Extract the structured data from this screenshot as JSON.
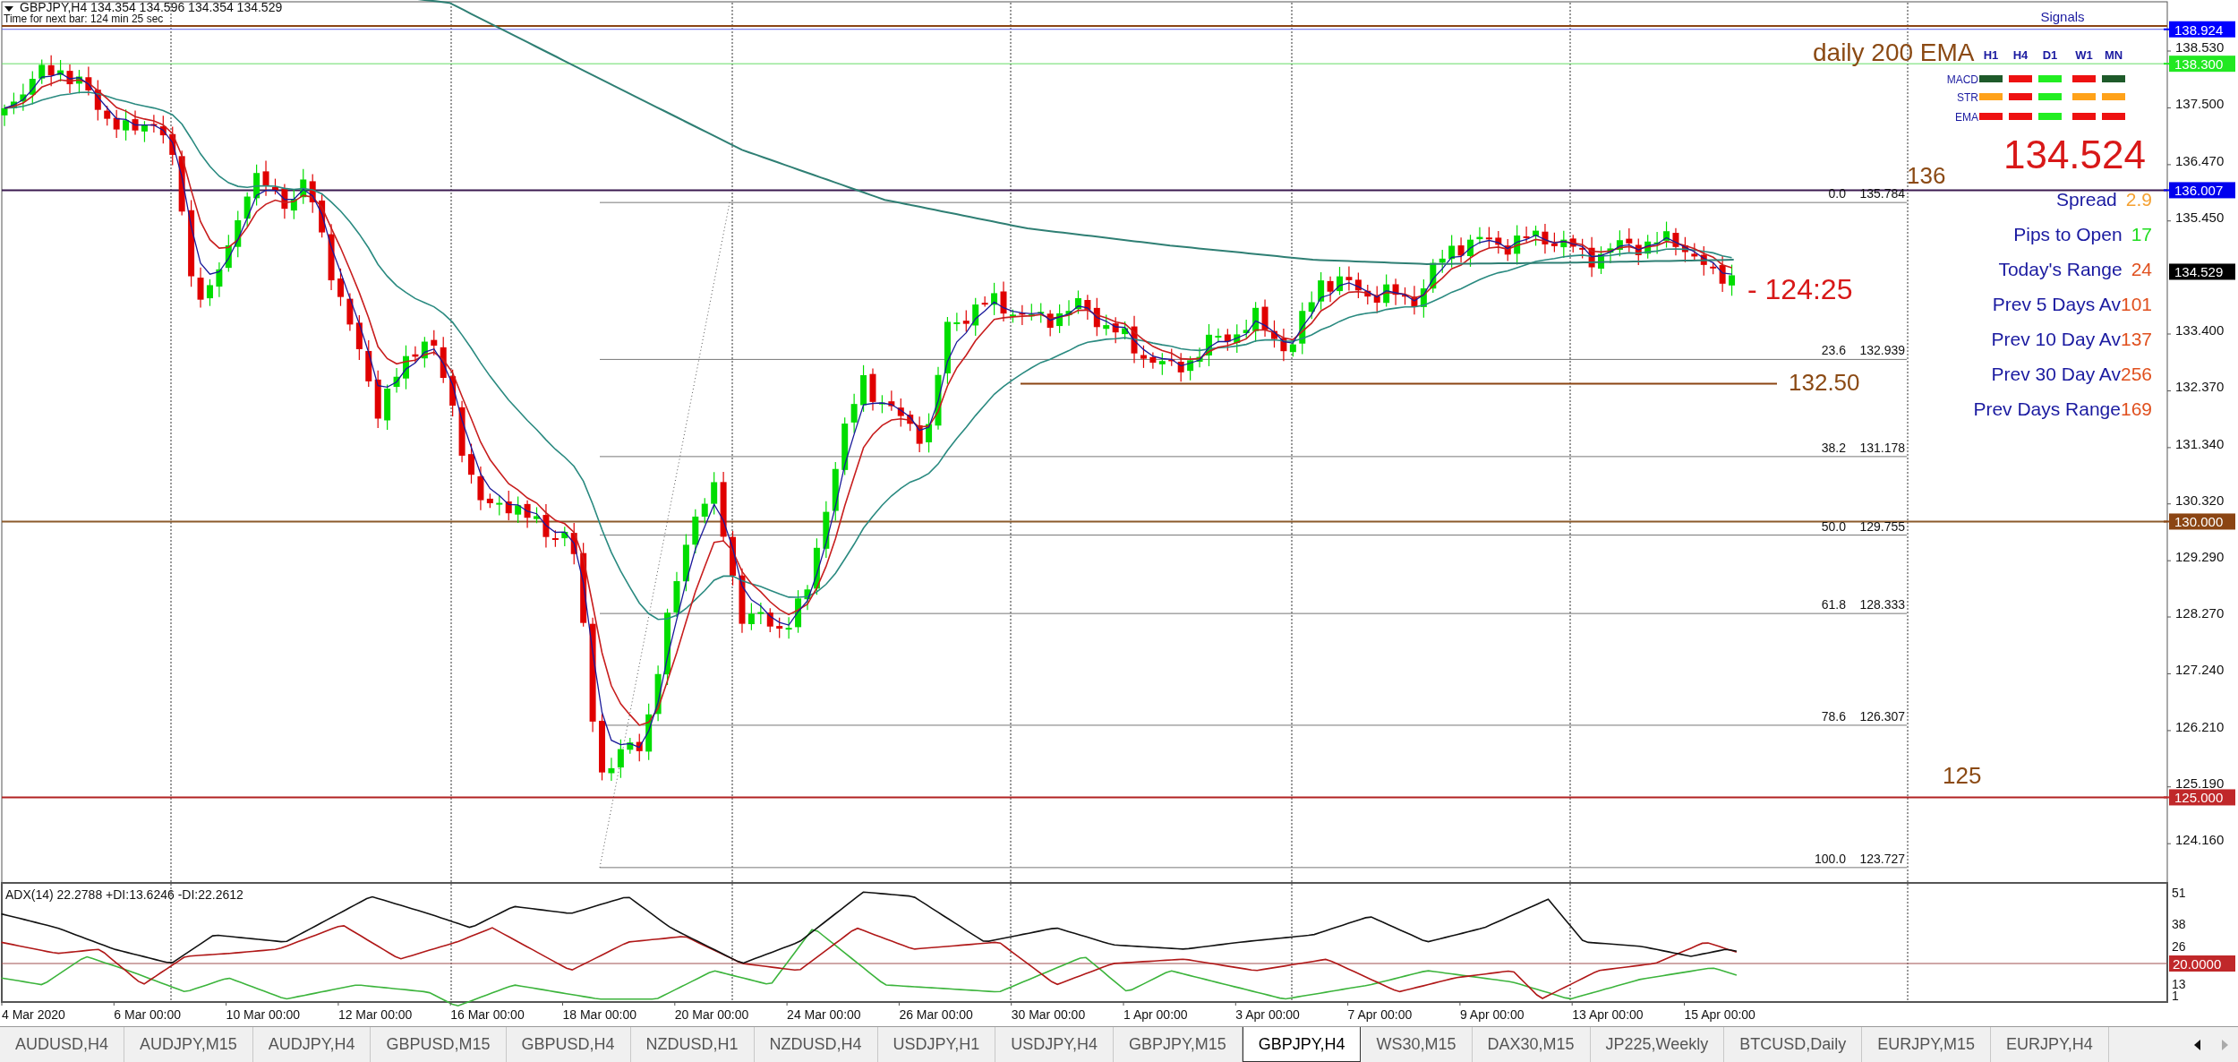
{
  "chart": {
    "title": "GBPJPY,H4  134.354 134.596 134.354 134.529",
    "timer": "Time for next bar: 124 min 25 sec",
    "price_axis": [
      "138.530",
      "137.500",
      "136.470",
      "135.450",
      "133.400",
      "132.370",
      "131.340",
      "130.320",
      "129.290",
      "128.270",
      "127.240",
      "126.210",
      "125.190",
      "124.160"
    ],
    "price_tags": [
      {
        "label": "138.924",
        "color": "#0000ff",
        "line": true
      },
      {
        "label": "138.300",
        "color": "#22e822",
        "line": true
      },
      {
        "label": "136.007",
        "color": "#0000ee",
        "line": true
      },
      {
        "label": "134.529",
        "color": "#000000",
        "line": false
      },
      {
        "label": "130.000",
        "color": "#8b4513",
        "line": true
      },
      {
        "label": "125.000",
        "color": "#c0282a",
        "line": true
      }
    ],
    "fibonacci": [
      {
        "level": "0.0",
        "price": "135.784"
      },
      {
        "level": "23.6",
        "price": "132.939"
      },
      {
        "level": "38.2",
        "price": "131.178"
      },
      {
        "level": "50.0",
        "price": "129.755"
      },
      {
        "level": "61.8",
        "price": "128.333"
      },
      {
        "level": "78.6",
        "price": "126.307"
      },
      {
        "level": "100.0",
        "price": "123.727"
      }
    ],
    "annotations": [
      {
        "text": "daily 200 EMA",
        "color": "#8b4a14"
      },
      {
        "text": "136",
        "color": "#8b4a14"
      },
      {
        "text": "132.50",
        "color": "#8b4a14"
      },
      {
        "text": "125",
        "color": "#8b4a14"
      },
      {
        "text": "- 124:25",
        "color": "#d81818"
      }
    ],
    "last_price": "134.524",
    "signals": {
      "title": "Signals",
      "columns": [
        "H1",
        "H4",
        "D1",
        "W1",
        "MN"
      ],
      "rows": [
        {
          "label": "MACD",
          "cells": [
            {
              "color": "#1e5a2a"
            },
            {
              "color": "#ee1111"
            },
            {
              "color": "#22ee22"
            },
            {
              "color": "#ee1111"
            },
            {
              "color": "#1e5a2a"
            }
          ]
        },
        {
          "label": "STR",
          "cells": [
            {
              "color": "#ffa21a"
            },
            {
              "color": "#ee1111"
            },
            {
              "color": "#22ee22"
            },
            {
              "color": "#ffa21a"
            },
            {
              "color": "#ffa21a"
            }
          ]
        },
        {
          "label": "EMA",
          "cells": [
            {
              "color": "#ee1111"
            },
            {
              "color": "#ee1111"
            },
            {
              "color": "#22ee22"
            },
            {
              "color": "#ee1111"
            },
            {
              "color": "#ee1111"
            }
          ]
        }
      ]
    },
    "stats": [
      {
        "label": "Spread",
        "value": "2.9",
        "color": "#f5a030"
      },
      {
        "label": "Pips to Open",
        "value": "17",
        "color": "#22dd22"
      },
      {
        "label": "Today's Range",
        "value": "24",
        "color": "#e0501e"
      },
      {
        "label": "Prev 5 Days Av",
        "value": "101",
        "color": "#e0501e"
      },
      {
        "label": "Prev 10 Day Av",
        "value": "137",
        "color": "#e0501e"
      },
      {
        "label": "Prev 30 Day Av",
        "value": "256",
        "color": "#e0501e"
      },
      {
        "label": "Prev Days Range",
        "value": "169",
        "color": "#e0501e"
      }
    ]
  },
  "indicator": {
    "label": "ADX(14) 22.2788 +DI:13.6246 -DI:22.2612",
    "axis": [
      "51",
      "38",
      "26",
      "13",
      "1"
    ],
    "tag": {
      "label": "20.0000",
      "color": "#c0282a"
    }
  },
  "time_axis": [
    "4 Mar 2020",
    "6 Mar 00:00",
    "10 Mar 00:00",
    "12 Mar 00:00",
    "16 Mar 00:00",
    "18 Mar 00:00",
    "20 Mar 00:00",
    "24 Mar 00:00",
    "26 Mar 00:00",
    "30 Mar 00:00",
    "1 Apr 00:00",
    "3 Apr 00:00",
    "7 Apr 00:00",
    "9 Apr 00:00",
    "13 Apr 00:00",
    "15 Apr 00:00"
  ],
  "tabs": [
    {
      "label": "AUDUSD,H4",
      "selected": false
    },
    {
      "label": "AUDJPY,M15",
      "selected": false
    },
    {
      "label": "AUDJPY,H4",
      "selected": false
    },
    {
      "label": "GBPUSD,M15",
      "selected": false
    },
    {
      "label": "GBPUSD,H4",
      "selected": false
    },
    {
      "label": "NZDUSD,H1",
      "selected": false
    },
    {
      "label": "NZDUSD,H4",
      "selected": false
    },
    {
      "label": "USDJPY,H1",
      "selected": false
    },
    {
      "label": "USDJPY,H4",
      "selected": false
    },
    {
      "label": "GBPJPY,M15",
      "selected": false
    },
    {
      "label": "GBPJPY,H4",
      "selected": true
    },
    {
      "label": "WS30,M15",
      "selected": false
    },
    {
      "label": "DAX30,M15",
      "selected": false
    },
    {
      "label": "JP225,Weekly",
      "selected": false
    },
    {
      "label": "BTCUSD,Daily",
      "selected": false
    },
    {
      "label": "EURJPY,M15",
      "selected": false
    },
    {
      "label": "EURJPY,H4",
      "selected": false
    }
  ]
}
